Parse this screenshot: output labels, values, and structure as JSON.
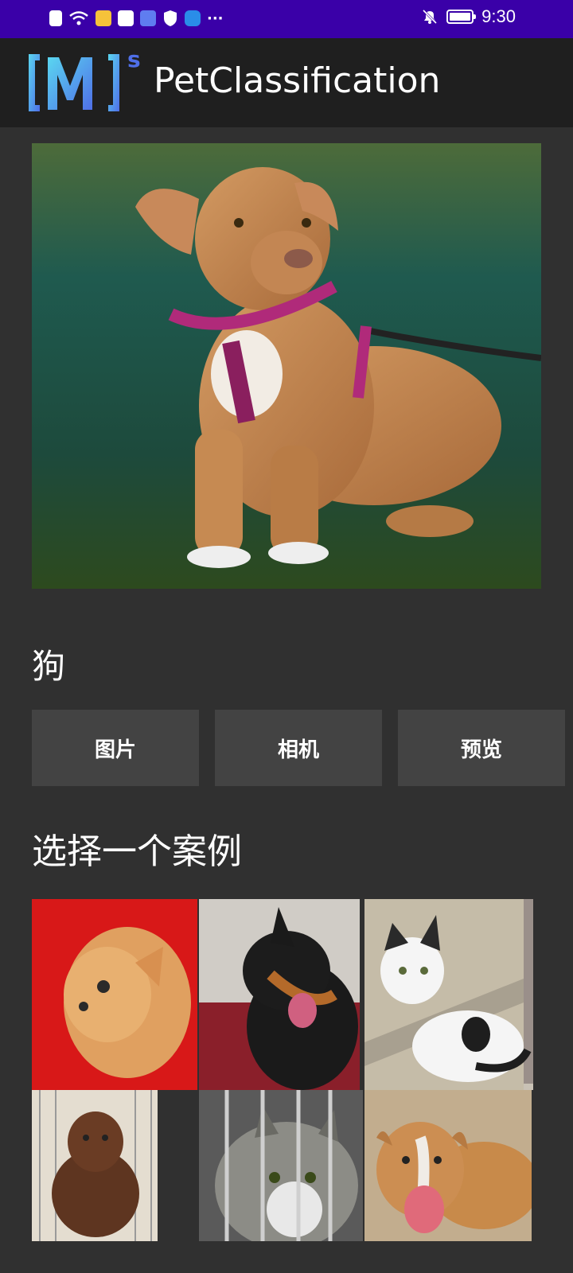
{
  "status_bar": {
    "time": "9:30",
    "more": "···"
  },
  "app": {
    "title": "PetClassification"
  },
  "result": {
    "label": "狗"
  },
  "buttons": {
    "image": "图片",
    "camera": "相机",
    "preview": "预览"
  },
  "examples": {
    "title": "选择一个案例",
    "items": [
      {
        "subject": "orange cat on red blanket"
      },
      {
        "subject": "black and tan dog with tongue out"
      },
      {
        "subject": "white and black kitten"
      },
      {
        "subject": "brown dog in kennel"
      },
      {
        "subject": "tabby cat behind bars"
      },
      {
        "subject": "tan dog lying on blanket"
      }
    ]
  },
  "colors": {
    "status_bar": "#3a00a8",
    "app_bar": "#1f1f1f",
    "background": "#303030",
    "button": "#434343"
  }
}
